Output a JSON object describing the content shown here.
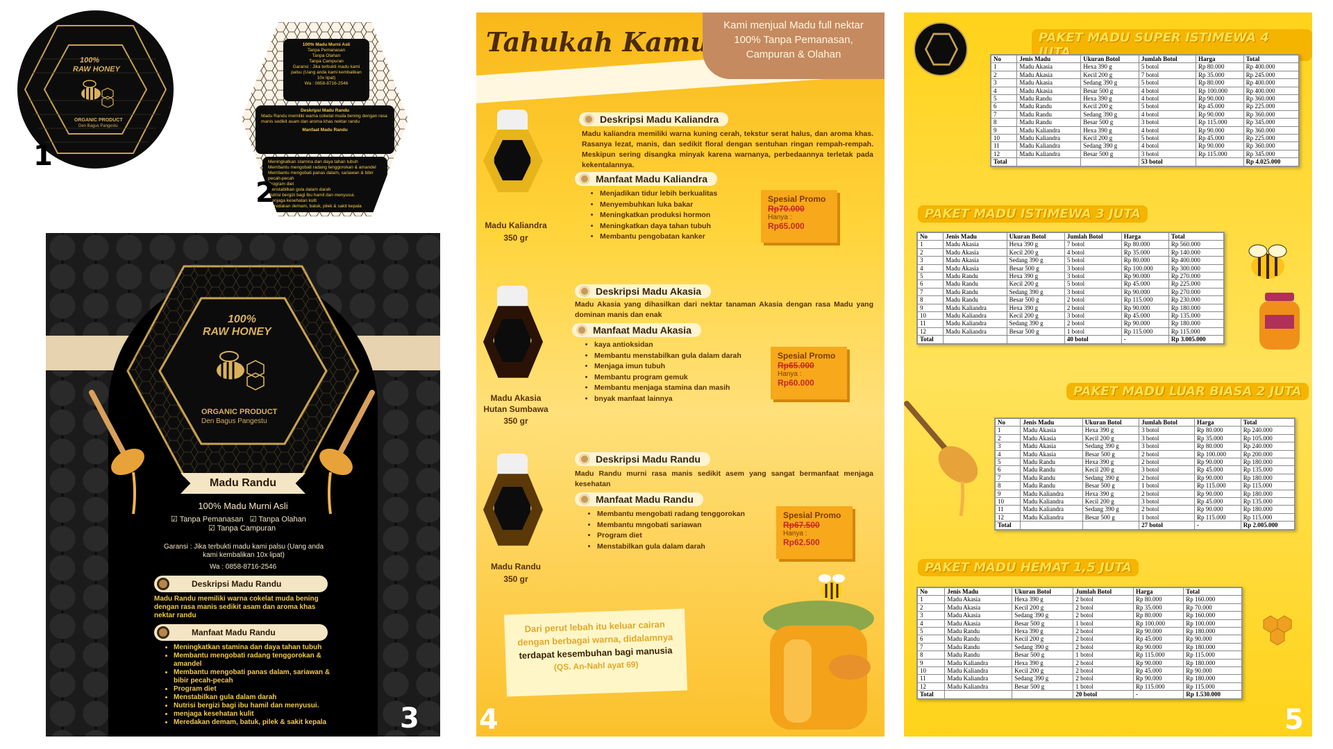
{
  "labels": {
    "n1": "1",
    "n2": "2",
    "n3": "3",
    "n4": "4",
    "n5": "5"
  },
  "logo": {
    "line1": "100%",
    "line2": "RAW HONEY",
    "org1": "ORGANIC PRODUCT",
    "org2": "Den Bagus Pangestu"
  },
  "label2": {
    "title": "100% Madu Murni Asli",
    "checks": [
      "Tanpa Pemanasan",
      "Tanpa Olahan",
      "Tanpa Campuran"
    ],
    "guarantee": "Garansi : Jika terbukti madu kami palsu (Uang anda kami kembalikan 10x lipat)",
    "wa": "Wa : 0858-8716-2546",
    "desc_title": "Deskripsi Madu Randu",
    "desc": "Madu Randu memiliki warna cokelat muda bening dengan rasa manis sedikit asam dan aroma khas nektar randu",
    "ben_title": "Manfaat Madu Randu",
    "benefits": [
      "Meningkatkan stamina dan daya tahan tubuh",
      "Membantu mengobati radang tenggorokan & amandel",
      "Membantu mengobati panas dalam, sariawan & bibir pecah-pecah",
      "Program diet",
      "Menstabilkan gula dalam darah",
      "Nutrisi bergizi bagi ibu hamil dan menyusui.",
      "menjaga kesehatan kulit",
      "Meredakan demam, batuk, pilek & sakit kepala"
    ]
  },
  "panel3": {
    "product": "Madu Randu",
    "title": "100% Madu Murni Asli",
    "check1": "Tanpa Pemanasan",
    "check2": "Tanpa Olahan",
    "check3": "Tanpa Campuran",
    "guarantee": "Garansi : Jika terbukti madu kami palsu (Uang anda kami kembalikan 10x lipat)",
    "wa": "Wa : 0858-8716-2546",
    "desc_title": "Deskripsi Madu Randu",
    "desc": "Madu Randu memiliki warna cokelat muda bening dengan  rasa manis sedikit asam dan aroma khas nektar randu",
    "ben_title": "Manfaat Madu Randu",
    "benefits": [
      "Meningkatkan stamina dan daya tahan tubuh",
      "Membantu mengobati radang tenggorokan & amandel",
      "Membantu mengobati panas dalam, sariawan & bibir pecah-pecah",
      "Program diet",
      "Menstabilkan gula dalam darah",
      "Nutrisi bergizi bagi ibu hamil dan menyusui.",
      "menjaga kesehatan kulit",
      "Meredakan demam, batuk, pilek & sakit kepala"
    ]
  },
  "panel4": {
    "heading": "Tahukah Kamu",
    "tagline": "Kami menjual Madu full nektar 100% Tanpa Pemanasan, Campuran & Olahan",
    "products": [
      {
        "name": "Madu Kaliandra",
        "size": "350 gr",
        "desc_title": "Deskripsi Madu Kaliandra",
        "desc": "Madu kaliandra memiliki warna kuning cerah, tekstur serat halus, dan aroma khas. Rasanya lezat, manis, dan sedikit floral dengan sentuhan ringan rempah-rempah. Meskipun sering disangka minyak karena warnanya, perbedaannya terletak pada kekentalannya.",
        "ben_title": "Manfaat Madu Kaliandra",
        "benefits": [
          "Menjadikan tidur lebih berkualitas",
          "Menyembuhkan luka bakar",
          "Meningkatkan produksi hormon",
          "Meningkatkan daya tahan tubuh",
          "Membantu pengobatan kanker"
        ],
        "promo": "Spesial Promo",
        "old": "Rp70.000",
        "hanya": "Hanya :",
        "new": "Rp65.000"
      },
      {
        "name": "Madu Akasia Hutan Sumbawa",
        "size": "350 gr",
        "desc_title": "Deskripsi Madu Akasia",
        "desc": "Madu Akasia yang dihasilkan dari nektar tanaman Akasia dengan rasa Madu yang dominan manis dan enak",
        "ben_title": "Manfaat Madu Akasia",
        "benefits": [
          "kaya antioksidan",
          "Membantu menstabilkan gula dalam darah",
          "Menjaga imun tubuh",
          "Membantu program gemuk",
          "Membantu menjaga stamina dan masih",
          "bnyak manfaat lainnya"
        ],
        "promo": "Spesial Promo",
        "old": "Rp65.000",
        "hanya": "Hanya :",
        "new": "Rp60.000"
      },
      {
        "name": "Madu Randu",
        "size": "350 gr",
        "desc_title": "Deskripsi Madu Randu",
        "desc": "Madu Randu murni rasa manis sedikit asem yang sangat bermanfaat menjaga kesehatan",
        "ben_title": "Manfaat Madu Randu",
        "benefits": [
          "Membantu mengobati radang tenggorokan",
          "Membantu mngobati sariawan",
          "Program diet",
          "Menstabilkan gula dalam darah"
        ],
        "promo": "Spesial Promo",
        "old": "Rp67.500",
        "hanya": "Hanya :",
        "new": "Rp62.500"
      }
    ],
    "quote1": "Dari perut lebah itu keluar cairan",
    "quote2": "dengan berbagai warna, didalamnya",
    "quote3": "terdapat kesembuhan bagi manusia",
    "quote4": "(QS. An-Nahl ayat 69)"
  },
  "panel5": {
    "headers": [
      "No",
      "Jenis Madu",
      "Ukuran Botol",
      "Jumlah Botol",
      "Harga",
      "Total"
    ],
    "packages": [
      {
        "title": "PAKET MADU SUPER ISTIMEWA 4 JUTA",
        "rows": [
          [
            "1",
            "Madu Akasia",
            "Hexa 390 g",
            "5 botol",
            "Rp 80.000",
            "Rp 400.000"
          ],
          [
            "2",
            "Madu Akasia",
            "Kecil 200 g",
            "7 botol",
            "Rp 35.000",
            "Rp 245.000"
          ],
          [
            "3",
            "Madu Akasia",
            "Sedang 390 g",
            "5 botol",
            "Rp 80.000",
            "Rp 400.000"
          ],
          [
            "4",
            "Madu Akasia",
            "Besar 500 g",
            "4 botol",
            "Rp 100.000",
            "Rp 400.000"
          ],
          [
            "5",
            "Madu Randu",
            "Hexa 390 g",
            "4 botol",
            "Rp 90.000",
            "Rp 360.000"
          ],
          [
            "6",
            "Madu Randu",
            "Kecil 200 g",
            "5 botol",
            "Rp 45.000",
            "Rp 225.000"
          ],
          [
            "7",
            "Madu Randu",
            "Sedang 390 g",
            "4 botol",
            "Rp 90.000",
            "Rp 360.000"
          ],
          [
            "8",
            "Madu Randu",
            "Besar 500 g",
            "3 botol",
            "Rp 115.000",
            "Rp 345.000"
          ],
          [
            "9",
            "Madu Kaliandra",
            "Hexa 390 g",
            "4 botol",
            "Rp 90.000",
            "Rp 360.000"
          ],
          [
            "10",
            "Madu Kaliandra",
            "Kecil 200 g",
            "5 botol",
            "Rp 45.000",
            "Rp 225.000"
          ],
          [
            "11",
            "Madu Kaliandra",
            "Sedang 390 g",
            "4 botol",
            "Rp 90.000",
            "Rp 360.000"
          ],
          [
            "12",
            "Madu Kaliandra",
            "Besar 500 g",
            "3 botol",
            "Rp 115.000",
            "Rp 345.000"
          ]
        ],
        "total": [
          "Total",
          "",
          "",
          "53 botol",
          "",
          "Rp 4.025.000"
        ]
      },
      {
        "title": "PAKET MADU ISTIMEWA 3 JUTA",
        "rows": [
          [
            "1",
            "Madu Akasia",
            "Hexa 390 g",
            "7 botol",
            "Rp 80.000",
            "Rp 560.000"
          ],
          [
            "2",
            "Madu Akasia",
            "Kecil 200 g",
            "4 botol",
            "Rp 35.000",
            "Rp 140.000"
          ],
          [
            "3",
            "Madu Akasia",
            "Sedang 390 g",
            "5 botol",
            "Rp 80.000",
            "Rp 400.000"
          ],
          [
            "4",
            "Madu Akasia",
            "Besar 500 g",
            "3 botol",
            "Rp 100.000",
            "Rp 300.000"
          ],
          [
            "5",
            "Madu Randu",
            "Hexa 390 g",
            "3 botol",
            "Rp 90.000",
            "Rp 270.000"
          ],
          [
            "6",
            "Madu Randu",
            "Kecil 200 g",
            "5 botol",
            "Rp 45.000",
            "Rp 225.000"
          ],
          [
            "7",
            "Madu Randu",
            "Sedang 390 g",
            "3 botol",
            "Rp 90.000",
            "Rp 270.000"
          ],
          [
            "8",
            "Madu Randu",
            "Besar 500 g",
            "2 botol",
            "Rp 115.000",
            "Rp 230.000"
          ],
          [
            "9",
            "Madu Kaliandra",
            "Hexa 390 g",
            "2 botol",
            "Rp 90.000",
            "Rp 180.000"
          ],
          [
            "10",
            "Madu Kaliandra",
            "Kecil 200 g",
            "3 botol",
            "Rp 45.000",
            "Rp 135.000"
          ],
          [
            "11",
            "Madu Kaliandra",
            "Sedang 390 g",
            "2 botol",
            "Rp 90.000",
            "Rp 180.000"
          ],
          [
            "12",
            "Madu Kaliandra",
            "Besar 500 g",
            "1 botol",
            "Rp 115.000",
            "Rp 115.000"
          ]
        ],
        "total": [
          "Total",
          "",
          "",
          "40 botol",
          "-",
          "Rp 3.005.000"
        ]
      },
      {
        "title": "PAKET MADU LUAR BIASA 2 JUTA",
        "rows": [
          [
            "1",
            "Madu Akasia",
            "Hexa 390 g",
            "3 botol",
            "Rp 80.000",
            "Rp 240.000"
          ],
          [
            "2",
            "Madu Akasia",
            "Kecil 200 g",
            "3 botol",
            "Rp 35.000",
            "Rp 105.000"
          ],
          [
            "3",
            "Madu Akasia",
            "Sedang 390 g",
            "3 botol",
            "Rp 80.000",
            "Rp 240.000"
          ],
          [
            "4",
            "Madu Akasia",
            "Besar 500 g",
            "2 botol",
            "Rp 100.000",
            "Rp 200.000"
          ],
          [
            "5",
            "Madu Randu",
            "Hexa 390 g",
            "2 botol",
            "Rp 90.000",
            "Rp 180.000"
          ],
          [
            "6",
            "Madu Randu",
            "Kecil 200 g",
            "3 botol",
            "Rp 45.000",
            "Rp 135.000"
          ],
          [
            "7",
            "Madu Randu",
            "Sedang 390 g",
            "2 botol",
            "Rp 90.000",
            "Rp 180.000"
          ],
          [
            "8",
            "Madu Randu",
            "Besar 500 g",
            "1 botol",
            "Rp 115.000",
            "Rp 115.000"
          ],
          [
            "9",
            "Madu Kaliandra",
            "Hexa 390 g",
            "2 botol",
            "Rp 90.000",
            "Rp 180.000"
          ],
          [
            "10",
            "Madu Kaliandra",
            "Kecil 200 g",
            "3 botol",
            "Rp 45.000",
            "Rp 135.000"
          ],
          [
            "11",
            "Madu Kaliandra",
            "Sedang 390 g",
            "2 botol",
            "Rp 90.000",
            "Rp 180.000"
          ],
          [
            "12",
            "Madu Kaliandra",
            "Besar 500 g",
            "1 botol",
            "Rp 115.000",
            "Rp 115.000"
          ]
        ],
        "total": [
          "Total",
          "",
          "",
          "27 botol",
          "-",
          "Rp 2.005.000"
        ]
      },
      {
        "title": "PAKET MADU HEMAT 1,5 JUTA",
        "rows": [
          [
            "1",
            "Madu Akasia",
            "Hexa 390 g",
            "2 botol",
            "Rp 80.000",
            "Rp 160.000"
          ],
          [
            "2",
            "Madu Akasia",
            "Kecil 200 g",
            "2 botol",
            "Rp 35.000",
            "Rp 70.000"
          ],
          [
            "3",
            "Madu Akasia",
            "Sedang 390 g",
            "2 botol",
            "Rp 80.000",
            "Rp 160.000"
          ],
          [
            "4",
            "Madu Akasia",
            "Besar 500 g",
            "1 botol",
            "Rp 100.000",
            "Rp 100.000"
          ],
          [
            "5",
            "Madu Randu",
            "Hexa 390 g",
            "2 botol",
            "Rp 90.000",
            "Rp 180.000"
          ],
          [
            "6",
            "Madu Randu",
            "Kecil 200 g",
            "2 botol",
            "Rp 45.000",
            "Rp 90.000"
          ],
          [
            "7",
            "Madu Randu",
            "Sedang 390 g",
            "2 botol",
            "Rp 90.000",
            "Rp 180.000"
          ],
          [
            "8",
            "Madu Randu",
            "Besar 500 g",
            "1 botol",
            "Rp 115.000",
            "Rp 115.000"
          ],
          [
            "9",
            "Madu Kaliandra",
            "Hexa 390 g",
            "2 botol",
            "Rp 90.000",
            "Rp 180.000"
          ],
          [
            "10",
            "Madu Kaliandra",
            "Kecil 200 g",
            "2 botol",
            "Rp 45.000",
            "Rp 90.000"
          ],
          [
            "11",
            "Madu Kaliandra",
            "Sedang 390 g",
            "2 botol",
            "Rp 90.000",
            "Rp 180.000"
          ],
          [
            "12",
            "Madu Kaliandra",
            "Besar 500 g",
            "1 botol",
            "Rp 115.000",
            "Rp 115.000"
          ]
        ],
        "total": [
          "Total",
          "",
          "",
          "20 botol",
          "-",
          "Rp 1.530.000"
        ]
      }
    ]
  },
  "colors": {
    "gold": "#d9b15c",
    "honey": "#f7b500",
    "dark": "#0a0a0a",
    "cream": "#f4e6c4"
  },
  "icons": [
    "bee-icon",
    "hexagon-icon",
    "honey-dipper-icon",
    "honey-jar-icon",
    "check-icon"
  ]
}
